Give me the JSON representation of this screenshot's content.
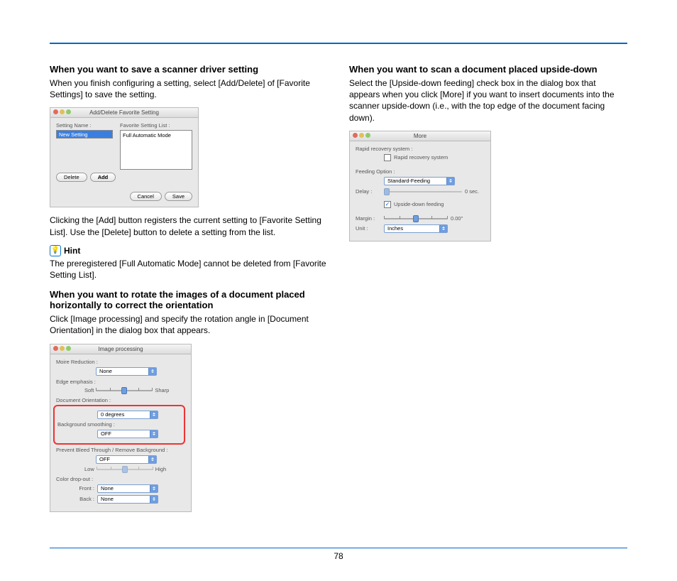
{
  "page_number": "78",
  "left": {
    "h1": "When you want to save a scanner driver setting",
    "p1": "When you finish configuring a setting, select [Add/Delete] of [Favorite Settings] to save the setting.",
    "dlg1": {
      "title": "Add/Delete Favorite Setting",
      "setting_name_label": "Setting Name :",
      "setting_name_value": "New Setting",
      "fav_list_label": "Favorite Setting List :",
      "fav_list_item": "Full Automatic Mode",
      "delete_btn": "Delete",
      "add_btn": "Add",
      "cancel_btn": "Cancel",
      "save_btn": "Save"
    },
    "p2": "Clicking the [Add] button registers the current setting to [Favorite Setting List]. Use the [Delete] button to delete a setting from the list.",
    "hint_label": "Hint",
    "hint_text": "The preregistered [Full Automatic Mode] cannot be deleted from [Favorite Setting List].",
    "h2": "When you want to rotate the images of a document placed horizontally to correct the orientation",
    "p3": "Click [Image processing] and specify the rotation angle in [Document Orientation] in the dialog box that appears.",
    "dlg2": {
      "title": "Image processing",
      "moire_label": "Moire Reduction :",
      "moire_value": "None",
      "edge_label": "Edge emphasis :",
      "edge_soft": "Soft",
      "edge_sharp": "Sharp",
      "orient_label": "Document Orientation :",
      "orient_value": "0 degrees",
      "bgsmooth_label": "Background smoothing :",
      "bgsmooth_value": "OFF",
      "bleed_label": "Prevent Bleed Through / Remove Background :",
      "bleed_value": "OFF",
      "bleed_low": "Low",
      "bleed_high": "High",
      "dropout_label": "Color drop-out :",
      "front_label": "Front :",
      "front_value": "None",
      "back_label": "Back :",
      "back_value": "None"
    }
  },
  "right": {
    "h1": "When you want to scan a document placed upside-down",
    "p1": "Select the [Upside-down feeding] check box in the dialog box that appears when you click [More] if you want to insert documents into the scanner upside-down (i.e., with the top edge of the document facing down).",
    "dlg": {
      "title": "More",
      "rapid_sys_label": "Rapid recovery system :",
      "rapid_chk_label": "Rapid recovery system",
      "feed_opt_label": "Feeding Option :",
      "feed_opt_value": "Standard-Feeding",
      "delay_label": "Delay :",
      "delay_value": "0 sec.",
      "upside_label": "Upside-down feeding",
      "margin_label": "Margin :",
      "margin_value": "0.00\"",
      "unit_label": "Unit :",
      "unit_value": "Inches"
    }
  }
}
